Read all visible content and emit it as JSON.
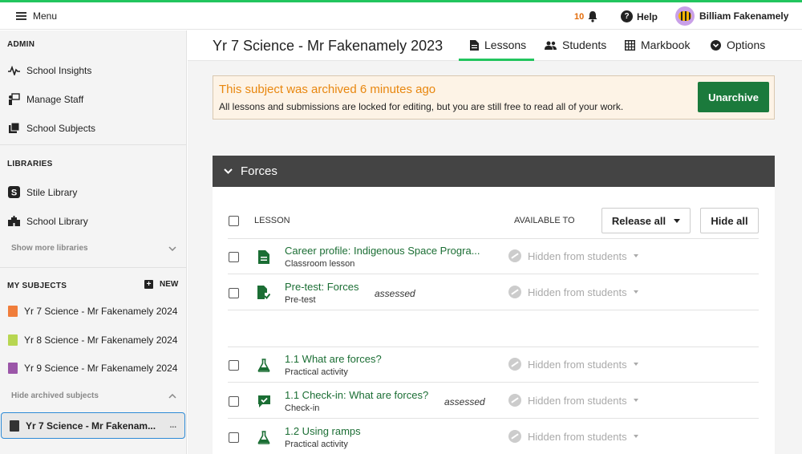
{
  "topbar": {
    "menu_label": "Menu",
    "notifications_count": "10",
    "help_label": "Help",
    "user_name": "Billiam Fakenamely",
    "accent_color": "#22c55e"
  },
  "sidebar": {
    "admin_title": "ADMIN",
    "admin_items": [
      {
        "label": "School Insights",
        "icon": "pulse-icon"
      },
      {
        "label": "Manage Staff",
        "icon": "teacher-icon"
      },
      {
        "label": "School Subjects",
        "icon": "books-icon"
      }
    ],
    "libraries_title": "LIBRARIES",
    "library_items": [
      {
        "label": "Stile Library",
        "icon": "stile-logo-icon"
      },
      {
        "label": "School Library",
        "icon": "school-building-icon"
      }
    ],
    "show_more_libraries": "Show more libraries",
    "my_subjects_title": "MY SUBJECTS",
    "new_label": "NEW",
    "subjects": [
      {
        "label": "Yr 7 Science - Mr Fakenamely 2024",
        "color": "#f07d3b"
      },
      {
        "label": "Yr 8 Science - Mr Fakenamely 2024",
        "color": "#b7d651"
      },
      {
        "label": "Yr 9 Science - Mr Fakenamely 2024",
        "color": "#9b56a8"
      }
    ],
    "hide_archived": "Hide archived subjects",
    "archived_subject": {
      "label": "Yr 7 Science - Mr Fakenam...",
      "more": "..."
    }
  },
  "header": {
    "title": "Yr 7 Science - Mr Fakenamely 2023",
    "tabs": [
      {
        "label": "Lessons",
        "icon": "document-icon",
        "active": true
      },
      {
        "label": "Students",
        "icon": "people-icon"
      },
      {
        "label": "Markbook",
        "icon": "grid-icon"
      },
      {
        "label": "Options",
        "icon": "options-icon"
      }
    ]
  },
  "banner": {
    "title": "This subject was archived 6 minutes ago",
    "message": "All lessons and submissions are locked for editing, but you are still free to read all of your work.",
    "button": "Unarchive"
  },
  "unit": {
    "title": "Forces",
    "column_lesson": "LESSON",
    "column_available": "AVAILABLE TO",
    "release_all": "Release all",
    "hide_all": "Hide all",
    "lessons": [
      {
        "title": "Career profile: Indigenous Space Progra...",
        "type": "Classroom lesson",
        "assessed": "",
        "visibility": "Hidden from students",
        "icon": "document-icon"
      },
      {
        "title": "Pre-test: Forces",
        "type": "Pre-test",
        "assessed": "assessed",
        "visibility": "Hidden from students",
        "icon": "pretest-icon"
      },
      {
        "title": "1.1 What are forces?",
        "type": "Practical activity",
        "assessed": "",
        "visibility": "Hidden from students",
        "icon": "flask-icon"
      },
      {
        "title": "1.1 Check-in: What are forces?",
        "type": "Check-in",
        "assessed": "assessed",
        "visibility": "Hidden from students",
        "icon": "checkin-icon"
      },
      {
        "title": "1.2 Using ramps",
        "type": "Practical activity",
        "assessed": "",
        "visibility": "Hidden from students",
        "icon": "flask-icon"
      }
    ]
  }
}
